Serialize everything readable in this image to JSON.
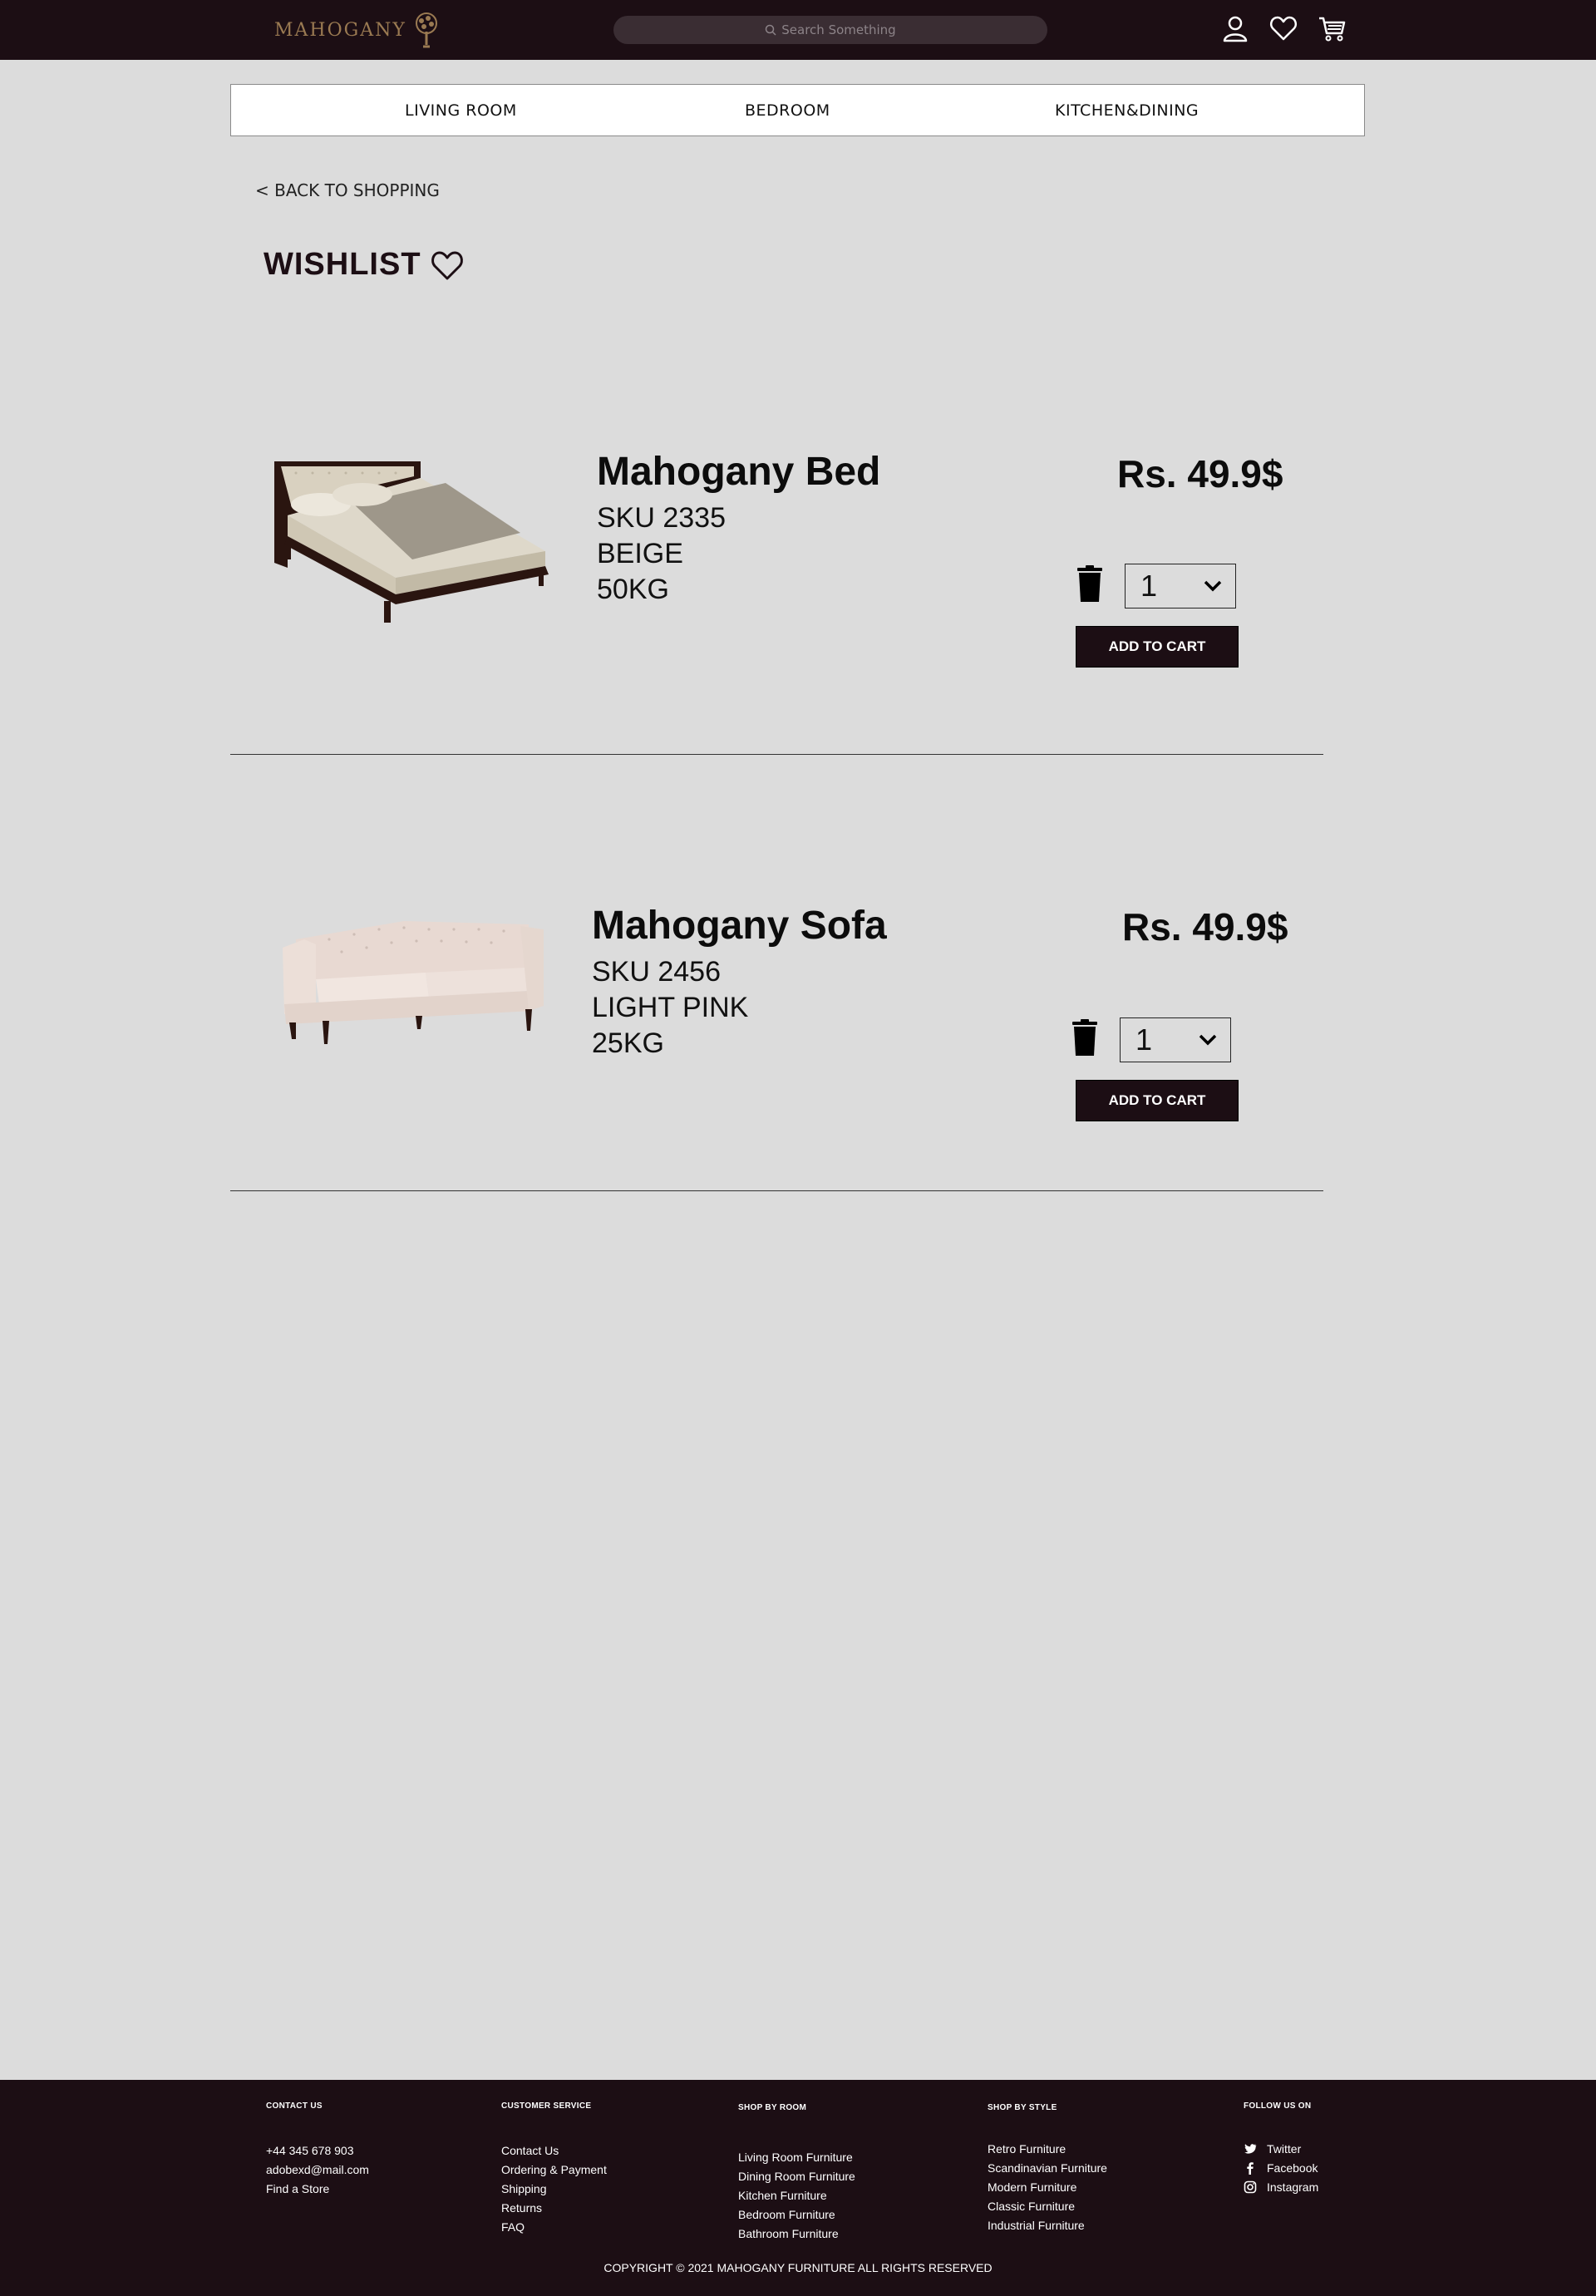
{
  "header": {
    "logo_text": "MAHOGANY",
    "search_placeholder": "Search Something",
    "icons": [
      "user-icon",
      "heart-icon",
      "cart-icon"
    ]
  },
  "nav": {
    "items": [
      "LIVING ROOM",
      "BEDROOM",
      "KITCHEN&DINING"
    ]
  },
  "back_link": "< BACK TO SHOPPING",
  "page_title": "WISHLIST",
  "products": [
    {
      "name": "Mahogany Bed",
      "sku": "SKU 2335",
      "color": "BEIGE",
      "weight": "50KG",
      "price": "Rs. 49.9$",
      "quantity": "1",
      "add_to_cart": "ADD TO CART"
    },
    {
      "name": "Mahogany Sofa",
      "sku": "SKU 2456",
      "color": "LIGHT PINK",
      "weight": "25KG",
      "price": "Rs. 49.9$",
      "quantity": "1",
      "add_to_cart": "ADD TO CART"
    }
  ],
  "footer": {
    "contact": {
      "heading": "CONTACT US",
      "items": [
        "+44 345 678 903",
        "adobexd@mail.com",
        "Find a Store"
      ]
    },
    "service": {
      "heading": "CUSTOMER SERVICE",
      "items": [
        "Contact Us",
        "Ordering & Payment",
        "Shipping",
        "Returns",
        "FAQ"
      ]
    },
    "room": {
      "heading": "SHOP BY ROOM",
      "items": [
        "Living Room Furniture",
        "Dining Room Furniture",
        "Kitchen Furniture",
        "Bedroom Furniture",
        "Bathroom Furniture"
      ]
    },
    "style": {
      "heading": "SHOP BY STYLE",
      "items": [
        "Retro Furniture",
        "Scandinavian Furniture",
        "Modern Furniture",
        "Classic Furniture",
        "Industrial Furniture"
      ]
    },
    "follow": {
      "heading": "FOLLOW US ON",
      "items": [
        "Twitter",
        "Facebook",
        "Instagram"
      ]
    },
    "copyright": "COPYRIGHT © 2021 MAHOGANY FURNITURE ALL RIGHTS RESERVED"
  },
  "colors": {
    "dark": "#1c0e14",
    "background": "#dcdcdc",
    "logo": "#9a7a52"
  }
}
